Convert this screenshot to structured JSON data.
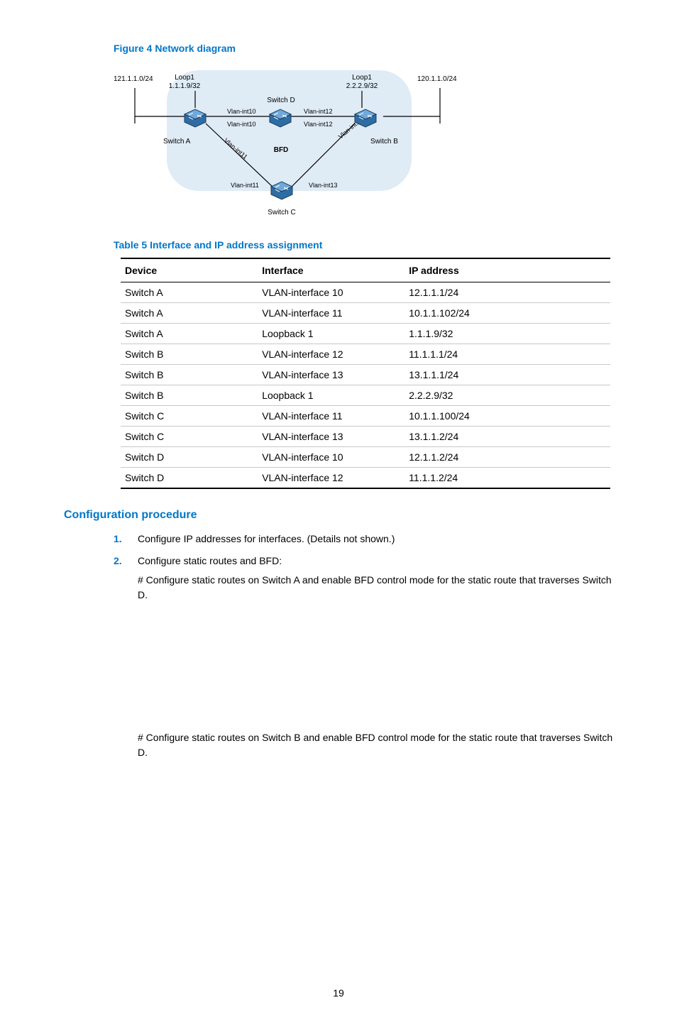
{
  "figure": {
    "caption": "Figure 4 Network diagram",
    "nodes": {
      "switch_a": "Switch A",
      "switch_b": "Switch B",
      "switch_c": "Switch C",
      "switch_d": "Switch D",
      "loop1_a": "Loop1",
      "loop1_a_ip": "1.1.1.9/32",
      "loop1_b": "Loop1",
      "loop1_b_ip": "2.2.2.9/32",
      "net_left": "121.1.1.0/24",
      "net_right": "120.1.1.0/24",
      "vlan10_top": "Vlan-int10",
      "vlan10_bot": "Vlan-int10",
      "vlan12_top": "Vlan-int12",
      "vlan12_bot": "Vlan-int12",
      "vlan11_a": "Vlan-int11",
      "vlan11_c": "Vlan-int11",
      "vlan13_b": "Vlan-int13",
      "vlan13_c": "Vlan-int13",
      "bfd": "BFD"
    }
  },
  "table": {
    "caption": "Table 5 Interface and IP address assignment",
    "headers": {
      "device": "Device",
      "interface": "Interface",
      "ip": "IP address"
    },
    "rows": [
      {
        "device": "Switch A",
        "interface": "VLAN-interface 10",
        "ip": "12.1.1.1/24"
      },
      {
        "device": "Switch A",
        "interface": "VLAN-interface 11",
        "ip": "10.1.1.102/24"
      },
      {
        "device": "Switch A",
        "interface": "Loopback 1",
        "ip": "1.1.1.9/32"
      },
      {
        "device": "Switch B",
        "interface": "VLAN-interface 12",
        "ip": "11.1.1.1/24"
      },
      {
        "device": "Switch B",
        "interface": "VLAN-interface 13",
        "ip": "13.1.1.1/24"
      },
      {
        "device": "Switch B",
        "interface": "Loopback 1",
        "ip": "2.2.2.9/32"
      },
      {
        "device": "Switch C",
        "interface": "VLAN-interface 11",
        "ip": "10.1.1.100/24"
      },
      {
        "device": "Switch C",
        "interface": "VLAN-interface 13",
        "ip": "13.1.1.2/24"
      },
      {
        "device": "Switch D",
        "interface": "VLAN-interface 10",
        "ip": "12.1.1.2/24"
      },
      {
        "device": "Switch D",
        "interface": "VLAN-interface 12",
        "ip": "11.1.1.2/24"
      }
    ]
  },
  "procedure": {
    "heading": "Configuration procedure",
    "steps": [
      {
        "text": "Configure IP addresses for interfaces. (Details not shown.)"
      },
      {
        "text": "Configure static routes and BFD:",
        "sub1": "# Configure static routes on Switch A and enable BFD control mode for the static route that traverses Switch D.",
        "sub2": "# Configure static routes on Switch B and enable BFD control mode for the static route that traverses Switch D."
      }
    ]
  },
  "page_number": "19"
}
